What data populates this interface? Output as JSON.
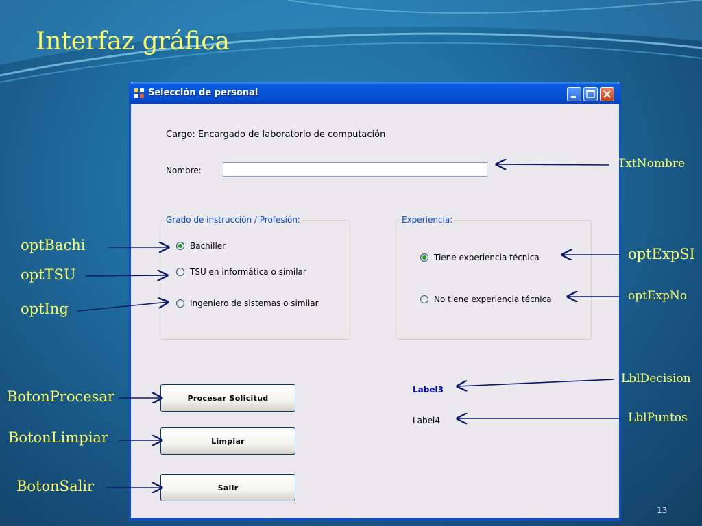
{
  "slide": {
    "title": "Interfaz gráfica",
    "page_number": "13",
    "title_color": "#ffff66"
  },
  "window": {
    "title": "Selección de personal",
    "icon": "app-window-icon",
    "controls": [
      "minimize-icon",
      "maximize-icon",
      "close-icon"
    ],
    "cargo_label": "Cargo: Encargado de laboratorio de computación",
    "nombre_label": "Nombre:",
    "nombre_value": "",
    "grado_group": {
      "legend": "Grado de instrucción / Profesión:",
      "options": [
        {
          "label": "Bachiller",
          "selected": true
        },
        {
          "label": "TSU en informática o similar",
          "selected": false
        },
        {
          "label": "Ingeniero de sistemas o similar",
          "selected": false
        }
      ]
    },
    "experiencia_group": {
      "legend": "Experiencia:",
      "options": [
        {
          "label": "Tiene experiencia técnica",
          "selected": true
        },
        {
          "label": "No tiene experiencia técnica",
          "selected": false
        }
      ]
    },
    "buttons": {
      "procesar": "Procesar Solicitud",
      "limpiar": "Limpiar",
      "salir": "Salir"
    },
    "label3": "Label3",
    "label4": "Label4"
  },
  "annotations": {
    "txt_nombre": "TxtNombre",
    "opt_bachi": "optBachi",
    "opt_tsu": "optTSU",
    "opt_ing": "optIng",
    "opt_exp_si": "optExpSI",
    "opt_exp_no": "optExpNo",
    "lbl_decision": "LblDecision",
    "lbl_puntos": "LblPuntos",
    "boton_procesar": "BotonProcesar",
    "boton_limpiar": "BotonLimpiar",
    "boton_salir": "BotonSalir"
  }
}
